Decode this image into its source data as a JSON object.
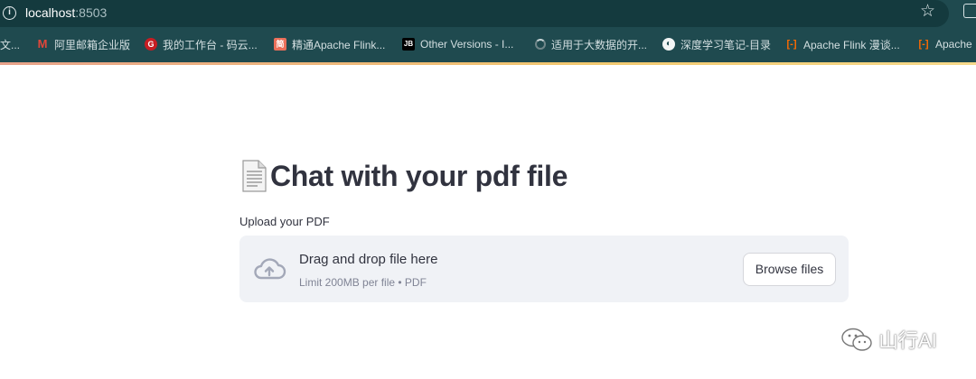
{
  "browser": {
    "url_host": "localhost",
    "url_port": ":8503",
    "bookmarks": [
      {
        "label": "文...",
        "icon": "none"
      },
      {
        "label": "阿里邮箱企业版",
        "icon": "gmail-icon"
      },
      {
        "label": "我的工作台 - 码云...",
        "icon": "gitee-icon"
      },
      {
        "label": "精通Apache Flink...",
        "icon": "jianshu-icon"
      },
      {
        "label": "Other Versions - I...",
        "icon": "jetbrains-icon"
      },
      {
        "label": "适用于大数据的开...",
        "icon": "loading-icon"
      },
      {
        "label": "深度学习笔记-目录",
        "icon": "globe-icon"
      },
      {
        "label": "Apache Flink 漫谈...",
        "icon": "aliyun-icon"
      },
      {
        "label": "Apache",
        "icon": "aliyun-icon"
      }
    ]
  },
  "page": {
    "title": "Chat with your pdf file",
    "title_icon": "page-facing-up-icon"
  },
  "uploader": {
    "label": "Upload your PDF",
    "drop_text": "Drag and drop file here",
    "limit_text": "Limit 200MB per file • PDF",
    "browse_label": "Browse files"
  },
  "watermark": {
    "text": "山行AI"
  },
  "colors": {
    "chrome_bg": "#1f4a4f",
    "text_primary": "#31333f",
    "dropzone_bg": "#f0f2f6"
  }
}
